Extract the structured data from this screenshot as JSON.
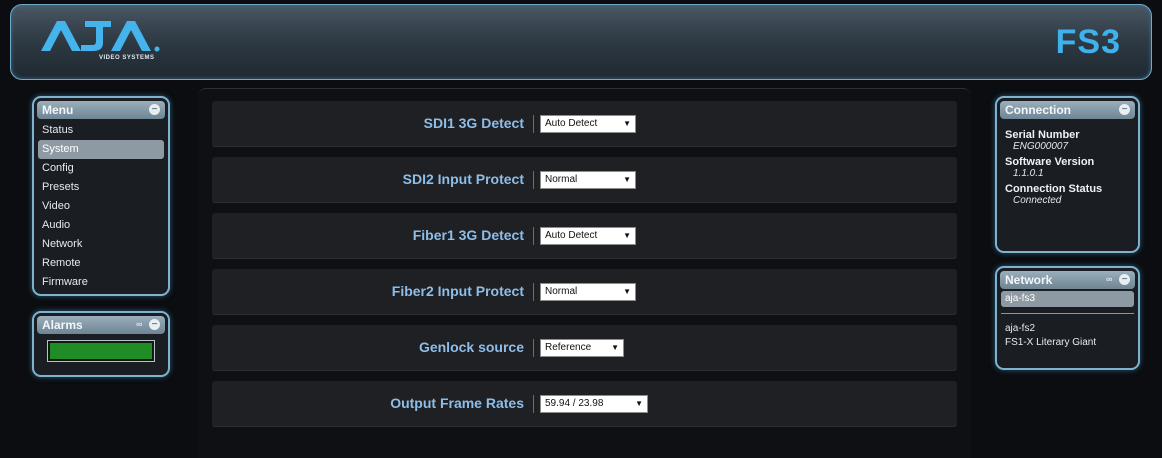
{
  "header": {
    "logo_sub": "VIDEO SYSTEMS",
    "product": "FS3"
  },
  "menu": {
    "title": "Menu",
    "items": [
      "Status",
      "System",
      "Config",
      "Presets",
      "Video",
      "Audio",
      "Network",
      "Remote",
      "Firmware"
    ],
    "active": "System"
  },
  "alarms": {
    "title": "Alarms",
    "status_color": "#1f8c25"
  },
  "settings": [
    {
      "label": "SDI1 3G Detect",
      "value": "Auto Detect"
    },
    {
      "label": "SDI2 Input Protect",
      "value": "Normal"
    },
    {
      "label": "Fiber1 3G Detect",
      "value": "Auto Detect"
    },
    {
      "label": "Fiber2 Input Protect",
      "value": "Normal"
    },
    {
      "label": "Genlock source",
      "value": "Reference"
    },
    {
      "label": "Output Frame Rates",
      "value": "59.94 / 23.98"
    }
  ],
  "connection": {
    "title": "Connection",
    "serial_label": "Serial Number",
    "serial_value": "ENG000007",
    "software_label": "Software Version",
    "software_value": "1.1.0.1",
    "status_label": "Connection Status",
    "status_value": "Connected"
  },
  "network": {
    "title": "Network",
    "active_device": "aja-fs3",
    "devices": [
      "aja-fs2",
      "FS1-X Literary Giant"
    ]
  },
  "colors": {
    "accent": "#3fb2ee",
    "label": "#8ebee8",
    "border": "#7fb2cf"
  }
}
